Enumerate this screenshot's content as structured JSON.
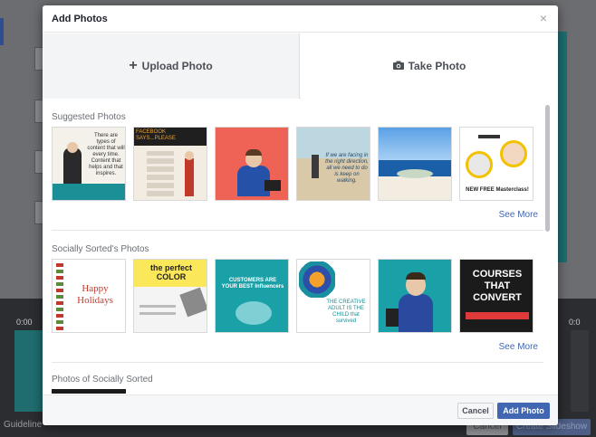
{
  "modal": {
    "title": "Add Photos",
    "close_glyph": "×",
    "upload_label": "Upload Photo",
    "take_label": "Take Photo",
    "cancel_label": "Cancel",
    "add_label": "Add Photo"
  },
  "sections": {
    "suggested": {
      "title": "Suggested Photos",
      "see_more": "See More",
      "thumbs": [
        {
          "text": "There are types of content that will every time. Content that helps and that inspires."
        },
        {
          "text": "FACEBOOK SAYS...PLEASE"
        },
        {
          "text": ""
        },
        {
          "text": "If we are facing in the right direction, all we need to do is keep on walking."
        },
        {
          "text": ""
        },
        {
          "text": "NEW FREE Masterclass!"
        }
      ]
    },
    "socially": {
      "title": "Socially Sorted's Photos",
      "see_more": "See More",
      "thumbs": [
        {
          "text": "Happy Holidays"
        },
        {
          "text": "the perfect COLOR"
        },
        {
          "text": "CUSTOMERS ARE YOUR BEST Influencers"
        },
        {
          "text": "THE CREATIVE ADULT IS THE CHILD that survived"
        },
        {
          "text": ""
        },
        {
          "text": "COURSES THAT CONVERT"
        }
      ]
    },
    "photos_of": {
      "title": "Photos of Socially Sorted"
    }
  },
  "background": {
    "time_left": "0:00",
    "time_right": "0:0",
    "guide_text": "Guideline",
    "cancel_label": "Cancel",
    "create_label": "Create Slideshow"
  },
  "colors": {
    "accent": "#4267b2",
    "teal": "#1aa1a8",
    "coral": "#ef6256"
  }
}
